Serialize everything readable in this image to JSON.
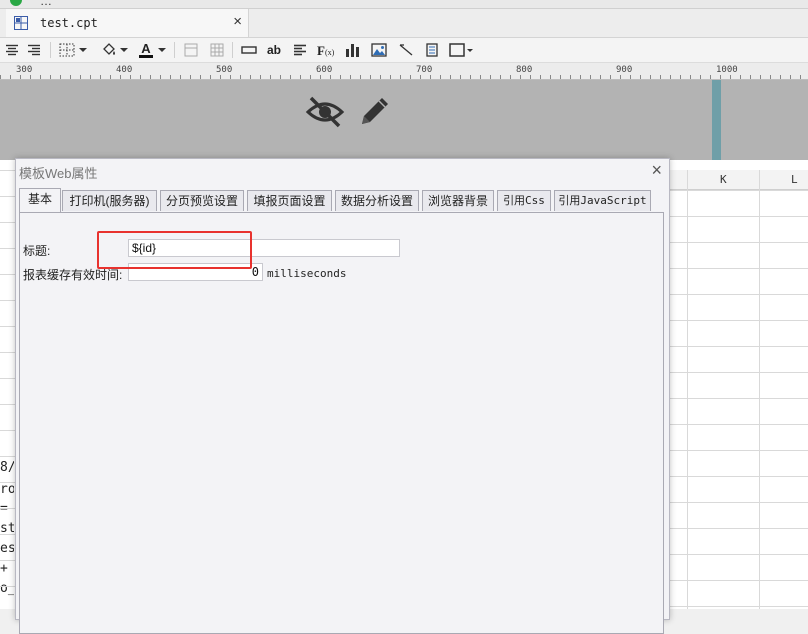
{
  "window": {
    "title_fragment": "…"
  },
  "file_tab": {
    "name": "test.cpt",
    "close": "×"
  },
  "ruler": {
    "labels": [
      "300",
      "400",
      "500",
      "600",
      "700",
      "800",
      "900",
      "1000"
    ]
  },
  "sheet": {
    "columns": [
      "K",
      "L"
    ],
    "left_fragments": [
      "8/",
      "ro",
      "= \"",
      "st",
      "es_",
      "+",
      "o_s"
    ]
  },
  "dialog": {
    "title": "模板Web属性",
    "close": "×",
    "tabs": [
      "基本",
      "打印机(服务器)",
      "分页预览设置",
      "填报页面设置",
      "数据分析设置",
      "浏览器背景",
      "引用Css",
      "引用JavaScript"
    ],
    "active_tab": 0,
    "fields": {
      "title_label": "标题:",
      "title_value": "${id}",
      "cache_label": "报表缓存有效时间:",
      "cache_value": "0",
      "cache_unit": "milliseconds"
    }
  },
  "colors": {
    "highlight": "#e8322e",
    "canvas_gray": "#b3b3b3",
    "column_marker": "#6f9fa8"
  }
}
